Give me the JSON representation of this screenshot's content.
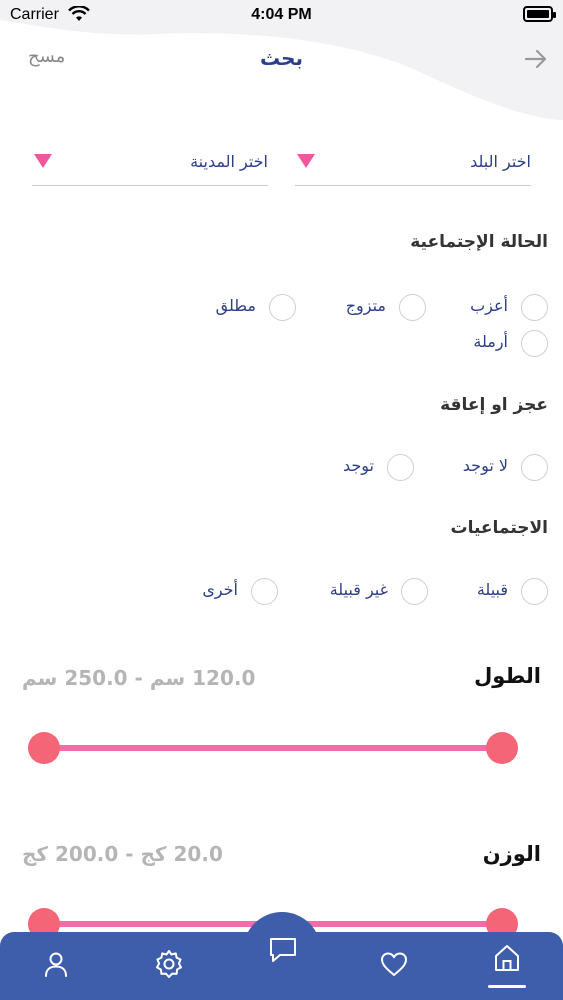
{
  "status_bar": {
    "carrier": "Carrier",
    "time": "4:04 PM"
  },
  "nav": {
    "clear_label": "مسح",
    "title": "بحث"
  },
  "location": {
    "country_placeholder": "اختر البلد",
    "city_placeholder": "اختر المدينة"
  },
  "marital_status": {
    "title": "الحالة الإجتماعية",
    "options": [
      "أعزب",
      "متزوج",
      "مطلق",
      "أرملة"
    ]
  },
  "disability": {
    "title": "عجز او إعاقة",
    "options": [
      "لا توجد",
      "توجد"
    ]
  },
  "social": {
    "title": "الاجتماعيات",
    "options": [
      "قبيلة",
      "غير قبيلة",
      "أخرى"
    ]
  },
  "height": {
    "title": "الطول",
    "value_text": "120.0 سم - 250.0 سم",
    "min": 120.0,
    "max": 250.0,
    "unit": "سم"
  },
  "weight": {
    "title": "الوزن",
    "value_text": "20.0 كج - 200.0 كج",
    "min": 20.0,
    "max": 200.0,
    "unit": "كج"
  },
  "tab_bar": {
    "active_tab": "home",
    "tabs": [
      "profile",
      "settings",
      "chat",
      "favorites",
      "home"
    ]
  },
  "colors": {
    "primary": "#2d3f8a",
    "tab_bar": "#3e5dab",
    "accent": "#f0579c",
    "slider_thumb": "#f46578",
    "slider_track": "#f06cab"
  }
}
